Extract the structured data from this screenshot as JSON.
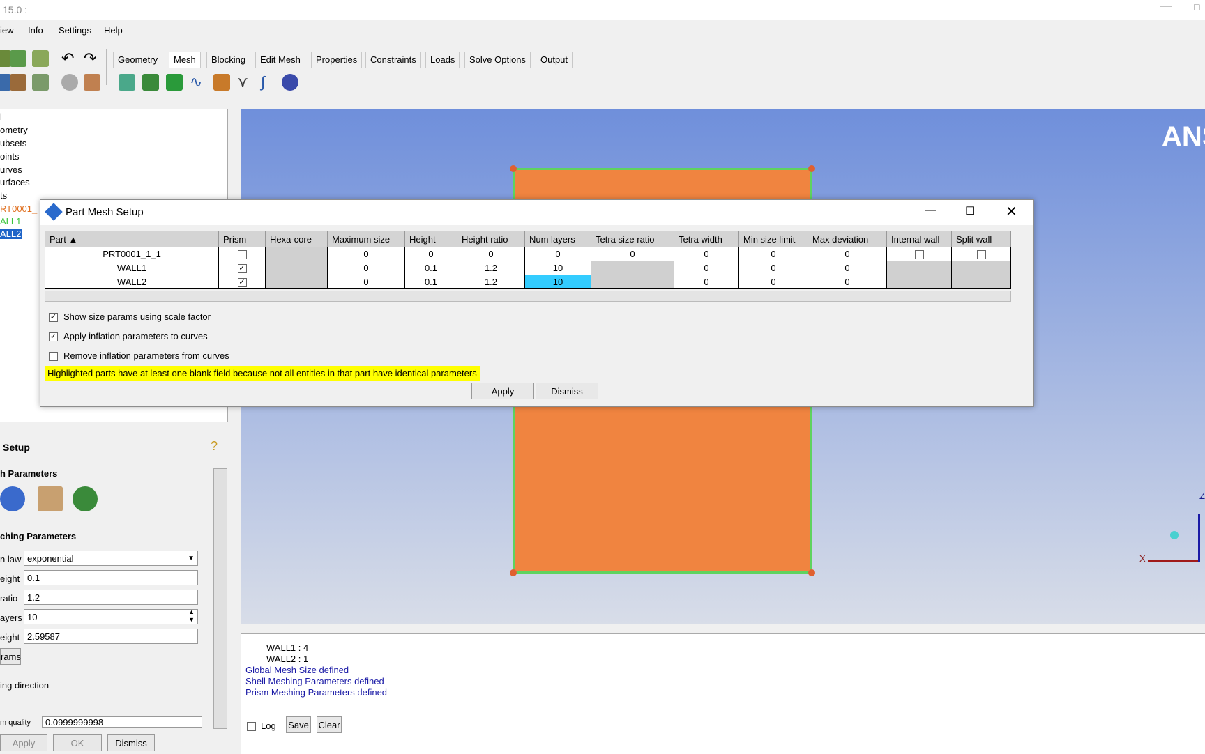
{
  "app": {
    "title": "15.0 :",
    "brand": "ANS"
  },
  "menu": [
    "iew",
    "Info",
    "Settings",
    "Help"
  ],
  "tabs": [
    "Geometry",
    "Mesh",
    "Blocking",
    "Edit Mesh",
    "Properties",
    "Constraints",
    "Loads",
    "Solve Options",
    "Output"
  ],
  "active_tab": "Mesh",
  "tree": [
    {
      "label": "l",
      "color": "#000"
    },
    {
      "label": "ometry",
      "color": "#000"
    },
    {
      "label": "ubsets",
      "color": "#000"
    },
    {
      "label": "oints",
      "color": "#000"
    },
    {
      "label": "urves",
      "color": "#000"
    },
    {
      "label": "urfaces",
      "color": "#000"
    },
    {
      "label": "ts",
      "color": "#000"
    },
    {
      "label": "RT0001_",
      "color": "#e07020"
    },
    {
      "label": "ALL1",
      "color": "#3ac43a"
    },
    {
      "label": "ALL2",
      "color": "#fff"
    }
  ],
  "left_panel": {
    "setup_title": "Setup",
    "mesh_params_title": "h Parameters",
    "meshing_params_title": "ching Parameters",
    "law_label": "n law",
    "law_value": "exponential",
    "height_label": "eight",
    "height_value": "0.1",
    "ratio_label": "ratio",
    "ratio_value": "1.2",
    "layers_label": "ayers",
    "layers_value": "10",
    "total_height_label": "eight",
    "total_height_value": "2.59587",
    "params_button": "rams",
    "direction_label": "ing direction",
    "quality_label": "m quality",
    "quality_value": "0.0999999998",
    "apply": "Apply",
    "ok": "OK",
    "dismiss": "Dismiss"
  },
  "dialog": {
    "title": "Part Mesh Setup",
    "columns": [
      "Part",
      "Prism",
      "Hexa-core",
      "Maximum size",
      "Height",
      "Height ratio",
      "Num layers",
      "Tetra size ratio",
      "Tetra width",
      "Min size limit",
      "Max deviation",
      "Internal wall",
      "Split wall"
    ],
    "rows": [
      {
        "part": "PRT0001_1_1",
        "prism": false,
        "max_size": "0",
        "height": "0",
        "height_ratio": "0",
        "num_layers": "0",
        "tetra_size_ratio": "0",
        "tetra_width": "0",
        "min_size_limit": "0",
        "max_deviation": "0"
      },
      {
        "part": "WALL1",
        "prism": true,
        "max_size": "0",
        "height": "0.1",
        "height_ratio": "1.2",
        "num_layers": "10",
        "tetra_size_ratio": "",
        "tetra_width": "0",
        "min_size_limit": "0",
        "max_deviation": "0"
      },
      {
        "part": "WALL2",
        "prism": true,
        "max_size": "0",
        "height": "0.1",
        "height_ratio": "1.2",
        "num_layers": "10",
        "tetra_size_ratio": "",
        "tetra_width": "0",
        "min_size_limit": "0",
        "max_deviation": "0"
      }
    ],
    "options": [
      {
        "label": "Show size params using scale factor",
        "checked": true
      },
      {
        "label": "Apply inflation parameters to curves",
        "checked": true
      },
      {
        "label": "Remove inflation parameters from curves",
        "checked": false
      }
    ],
    "warning": "Highlighted parts have at least one blank field because not all entities in that part have identical parameters",
    "apply": "Apply",
    "dismiss": "Dismiss"
  },
  "messages": [
    {
      "text": "WALL1 : 4",
      "color": "#000"
    },
    {
      "text": "WALL2 : 1",
      "color": "#000"
    },
    {
      "text": "Global Mesh Size defined",
      "color": "#1a1aa6"
    },
    {
      "text": "Shell Meshing Parameters defined",
      "color": "#1a1aa6"
    },
    {
      "text": "Prism Meshing Parameters defined",
      "color": "#1a1aa6"
    }
  ],
  "msg_controls": {
    "log": "Log",
    "save": "Save",
    "clear": "Clear"
  },
  "axes": {
    "x": "X",
    "z": "Z"
  }
}
